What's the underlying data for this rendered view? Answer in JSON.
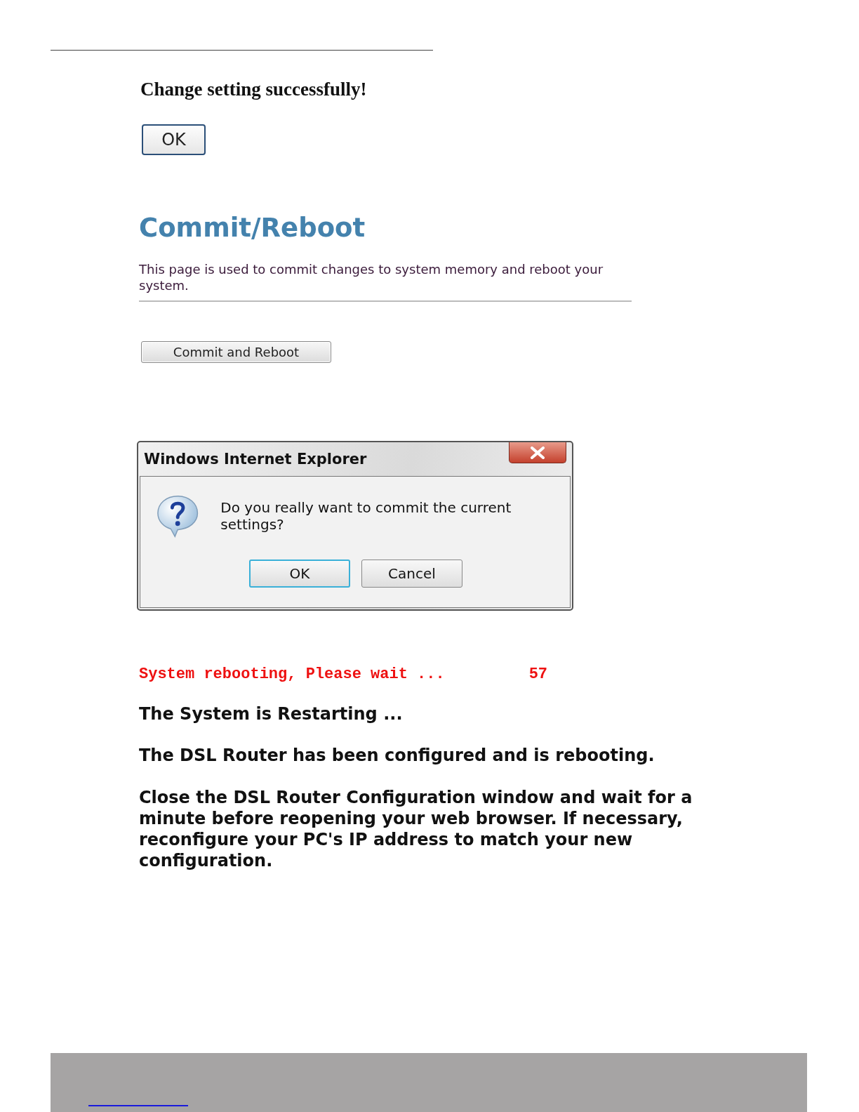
{
  "success": {
    "message": "Change setting successfully!",
    "button": "OK"
  },
  "commit_page": {
    "title": "Commit/Reboot",
    "description": "This page is used to commit changes to system memory and reboot your system.",
    "button": "Commit and Reboot"
  },
  "dialog": {
    "title": "Windows Internet Explorer",
    "message": "Do you really want to commit the current settings?",
    "buttons": [
      {
        "label": "OK",
        "focused": true
      },
      {
        "label": "Cancel",
        "focused": false
      }
    ]
  },
  "rebooting": {
    "status": "System rebooting, Please wait ...",
    "countdown": "57"
  },
  "restart": {
    "heading": "The System is Restarting ...",
    "lines": [
      "The DSL Router has been configured and is rebooting.",
      "Close the DSL Router Configuration window and wait for a minute before reopening your web browser. If necessary, reconfigure your PC's IP address to match your new configuration."
    ]
  }
}
